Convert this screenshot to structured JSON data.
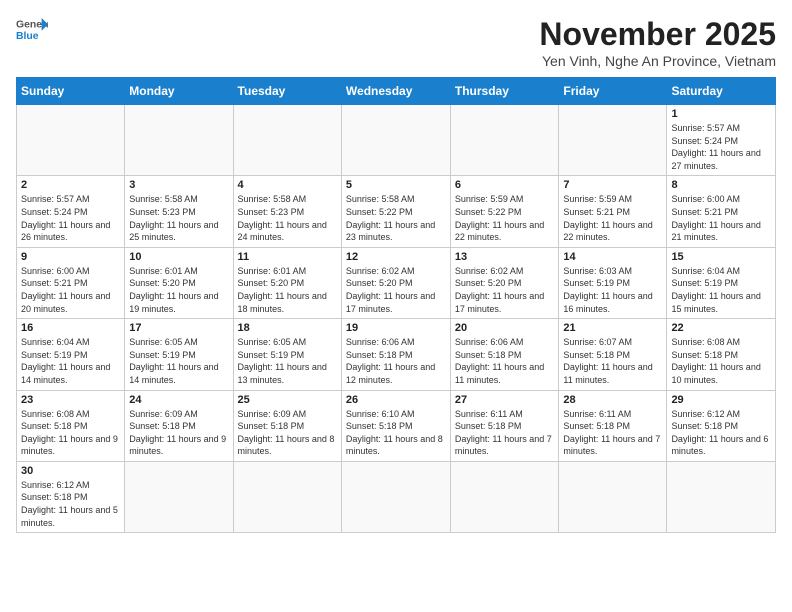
{
  "header": {
    "logo_general": "General",
    "logo_blue": "Blue",
    "month_title": "November 2025",
    "subtitle": "Yen Vinh, Nghe An Province, Vietnam"
  },
  "weekdays": [
    "Sunday",
    "Monday",
    "Tuesday",
    "Wednesday",
    "Thursday",
    "Friday",
    "Saturday"
  ],
  "days": {
    "d1": {
      "num": "1",
      "sunrise": "Sunrise: 5:57 AM",
      "sunset": "Sunset: 5:24 PM",
      "daylight": "Daylight: 11 hours and 27 minutes."
    },
    "d2": {
      "num": "2",
      "sunrise": "Sunrise: 5:57 AM",
      "sunset": "Sunset: 5:24 PM",
      "daylight": "Daylight: 11 hours and 26 minutes."
    },
    "d3": {
      "num": "3",
      "sunrise": "Sunrise: 5:58 AM",
      "sunset": "Sunset: 5:23 PM",
      "daylight": "Daylight: 11 hours and 25 minutes."
    },
    "d4": {
      "num": "4",
      "sunrise": "Sunrise: 5:58 AM",
      "sunset": "Sunset: 5:23 PM",
      "daylight": "Daylight: 11 hours and 24 minutes."
    },
    "d5": {
      "num": "5",
      "sunrise": "Sunrise: 5:58 AM",
      "sunset": "Sunset: 5:22 PM",
      "daylight": "Daylight: 11 hours and 23 minutes."
    },
    "d6": {
      "num": "6",
      "sunrise": "Sunrise: 5:59 AM",
      "sunset": "Sunset: 5:22 PM",
      "daylight": "Daylight: 11 hours and 22 minutes."
    },
    "d7": {
      "num": "7",
      "sunrise": "Sunrise: 5:59 AM",
      "sunset": "Sunset: 5:21 PM",
      "daylight": "Daylight: 11 hours and 22 minutes."
    },
    "d8": {
      "num": "8",
      "sunrise": "Sunrise: 6:00 AM",
      "sunset": "Sunset: 5:21 PM",
      "daylight": "Daylight: 11 hours and 21 minutes."
    },
    "d9": {
      "num": "9",
      "sunrise": "Sunrise: 6:00 AM",
      "sunset": "Sunset: 5:21 PM",
      "daylight": "Daylight: 11 hours and 20 minutes."
    },
    "d10": {
      "num": "10",
      "sunrise": "Sunrise: 6:01 AM",
      "sunset": "Sunset: 5:20 PM",
      "daylight": "Daylight: 11 hours and 19 minutes."
    },
    "d11": {
      "num": "11",
      "sunrise": "Sunrise: 6:01 AM",
      "sunset": "Sunset: 5:20 PM",
      "daylight": "Daylight: 11 hours and 18 minutes."
    },
    "d12": {
      "num": "12",
      "sunrise": "Sunrise: 6:02 AM",
      "sunset": "Sunset: 5:20 PM",
      "daylight": "Daylight: 11 hours and 17 minutes."
    },
    "d13": {
      "num": "13",
      "sunrise": "Sunrise: 6:02 AM",
      "sunset": "Sunset: 5:20 PM",
      "daylight": "Daylight: 11 hours and 17 minutes."
    },
    "d14": {
      "num": "14",
      "sunrise": "Sunrise: 6:03 AM",
      "sunset": "Sunset: 5:19 PM",
      "daylight": "Daylight: 11 hours and 16 minutes."
    },
    "d15": {
      "num": "15",
      "sunrise": "Sunrise: 6:04 AM",
      "sunset": "Sunset: 5:19 PM",
      "daylight": "Daylight: 11 hours and 15 minutes."
    },
    "d16": {
      "num": "16",
      "sunrise": "Sunrise: 6:04 AM",
      "sunset": "Sunset: 5:19 PM",
      "daylight": "Daylight: 11 hours and 14 minutes."
    },
    "d17": {
      "num": "17",
      "sunrise": "Sunrise: 6:05 AM",
      "sunset": "Sunset: 5:19 PM",
      "daylight": "Daylight: 11 hours and 14 minutes."
    },
    "d18": {
      "num": "18",
      "sunrise": "Sunrise: 6:05 AM",
      "sunset": "Sunset: 5:19 PM",
      "daylight": "Daylight: 11 hours and 13 minutes."
    },
    "d19": {
      "num": "19",
      "sunrise": "Sunrise: 6:06 AM",
      "sunset": "Sunset: 5:18 PM",
      "daylight": "Daylight: 11 hours and 12 minutes."
    },
    "d20": {
      "num": "20",
      "sunrise": "Sunrise: 6:06 AM",
      "sunset": "Sunset: 5:18 PM",
      "daylight": "Daylight: 11 hours and 11 minutes."
    },
    "d21": {
      "num": "21",
      "sunrise": "Sunrise: 6:07 AM",
      "sunset": "Sunset: 5:18 PM",
      "daylight": "Daylight: 11 hours and 11 minutes."
    },
    "d22": {
      "num": "22",
      "sunrise": "Sunrise: 6:08 AM",
      "sunset": "Sunset: 5:18 PM",
      "daylight": "Daylight: 11 hours and 10 minutes."
    },
    "d23": {
      "num": "23",
      "sunrise": "Sunrise: 6:08 AM",
      "sunset": "Sunset: 5:18 PM",
      "daylight": "Daylight: 11 hours and 9 minutes."
    },
    "d24": {
      "num": "24",
      "sunrise": "Sunrise: 6:09 AM",
      "sunset": "Sunset: 5:18 PM",
      "daylight": "Daylight: 11 hours and 9 minutes."
    },
    "d25": {
      "num": "25",
      "sunrise": "Sunrise: 6:09 AM",
      "sunset": "Sunset: 5:18 PM",
      "daylight": "Daylight: 11 hours and 8 minutes."
    },
    "d26": {
      "num": "26",
      "sunrise": "Sunrise: 6:10 AM",
      "sunset": "Sunset: 5:18 PM",
      "daylight": "Daylight: 11 hours and 8 minutes."
    },
    "d27": {
      "num": "27",
      "sunrise": "Sunrise: 6:11 AM",
      "sunset": "Sunset: 5:18 PM",
      "daylight": "Daylight: 11 hours and 7 minutes."
    },
    "d28": {
      "num": "28",
      "sunrise": "Sunrise: 6:11 AM",
      "sunset": "Sunset: 5:18 PM",
      "daylight": "Daylight: 11 hours and 7 minutes."
    },
    "d29": {
      "num": "29",
      "sunrise": "Sunrise: 6:12 AM",
      "sunset": "Sunset: 5:18 PM",
      "daylight": "Daylight: 11 hours and 6 minutes."
    },
    "d30": {
      "num": "30",
      "sunrise": "Sunrise: 6:12 AM",
      "sunset": "Sunset: 5:18 PM",
      "daylight": "Daylight: 11 hours and 5 minutes."
    }
  }
}
